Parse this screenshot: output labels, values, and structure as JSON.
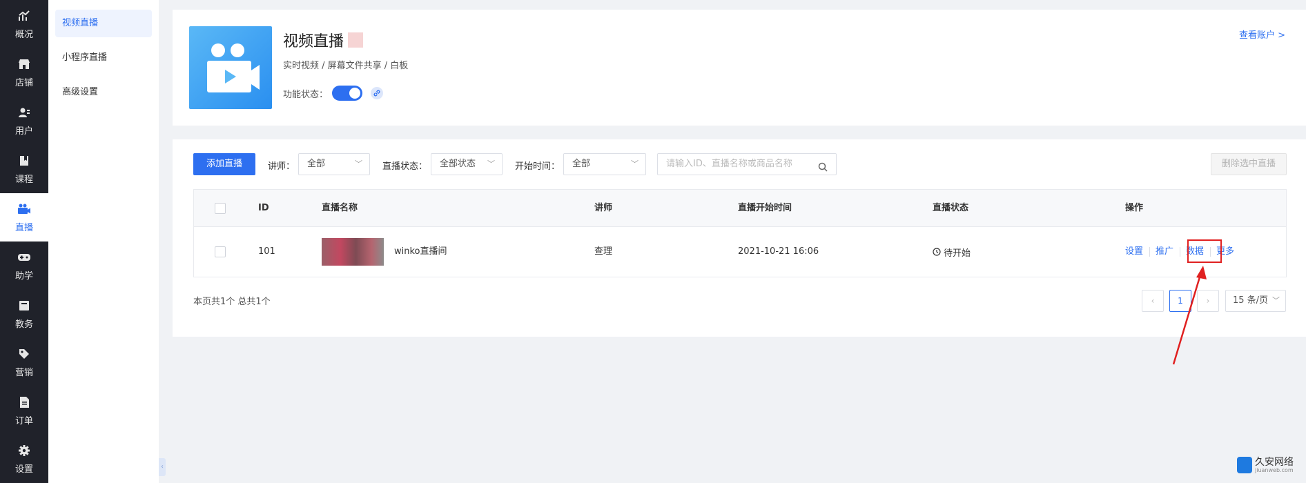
{
  "nav": {
    "items": [
      {
        "label": "概况",
        "icon": "chart-icon"
      },
      {
        "label": "店铺",
        "icon": "store-icon"
      },
      {
        "label": "用户",
        "icon": "users-icon"
      },
      {
        "label": "课程",
        "icon": "book-icon"
      },
      {
        "label": "直播",
        "icon": "camera-icon"
      },
      {
        "label": "助学",
        "icon": "gamepad-icon"
      },
      {
        "label": "教务",
        "icon": "notebook-icon"
      },
      {
        "label": "营销",
        "icon": "tag-icon"
      },
      {
        "label": "订单",
        "icon": "document-icon"
      },
      {
        "label": "设置",
        "icon": "gear-icon"
      }
    ],
    "active_index": 4
  },
  "subnav": {
    "items": [
      "视频直播",
      "小程序直播",
      "高级设置"
    ],
    "active_index": 0
  },
  "header": {
    "title": "视频直播",
    "subtitle": "实时视频 / 屏幕文件共享 / 白板",
    "status_label": "功能状态：",
    "status_on": true,
    "view_account": "查看账户 >"
  },
  "toolbar": {
    "add_label": "添加直播",
    "teacher_label": "讲师：",
    "teacher_value": "全部",
    "status_label": "直播状态：",
    "status_value": "全部状态",
    "time_label": "开始时间：",
    "time_value": "全部",
    "search_placeholder": "请输入ID、直播名称或商品名称",
    "delete_label": "删除选中直播"
  },
  "table": {
    "headers": [
      "ID",
      "直播名称",
      "讲师",
      "直播开始时间",
      "直播状态",
      "操作"
    ],
    "rows": [
      {
        "id": "101",
        "name": "winko直播间",
        "teacher": "查理",
        "start_time": "2021-10-21 16:06",
        "status": "待开始",
        "actions": [
          "设置",
          "推广",
          "数据",
          "更多"
        ]
      }
    ]
  },
  "footer": {
    "summary": "本页共1个 总共1个",
    "current_page": "1",
    "page_size": "15 条/页"
  },
  "watermark": {
    "text": "久安网络",
    "small": "jiuanweb.com"
  },
  "colors": {
    "accent": "#2d6ff0",
    "nav_bg": "#20222a",
    "highlight": "#e02020"
  }
}
